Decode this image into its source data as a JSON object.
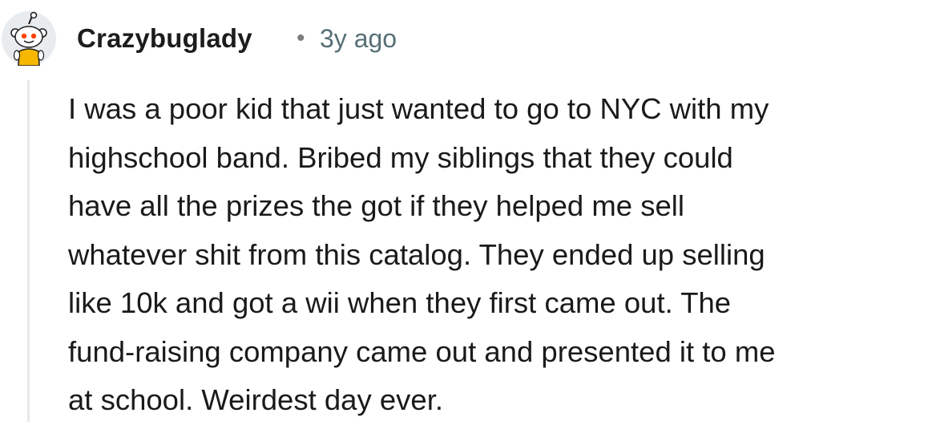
{
  "comment": {
    "author": "Crazybuglady",
    "separator": "•",
    "age": "3y ago",
    "avatar_icon": "snoo-avatar-icon",
    "body": "I was a poor kid that just wanted to go to NYC with my\nhighschool band. Bribed my siblings that they could\nhave all the prizes the got if they helped me sell\nwhatever shit from this catalog. They ended up selling\nlike 10k and got a wii when they first came out. The\nfund-raising company came out and presented it to me\nat school. Weirdest day ever."
  },
  "colors": {
    "username": "#1c1c1c",
    "age": "#576f76",
    "thread_line": "#e5e8ea",
    "avatar_body": "#f5b700",
    "avatar_eyes": "#ff4500"
  }
}
